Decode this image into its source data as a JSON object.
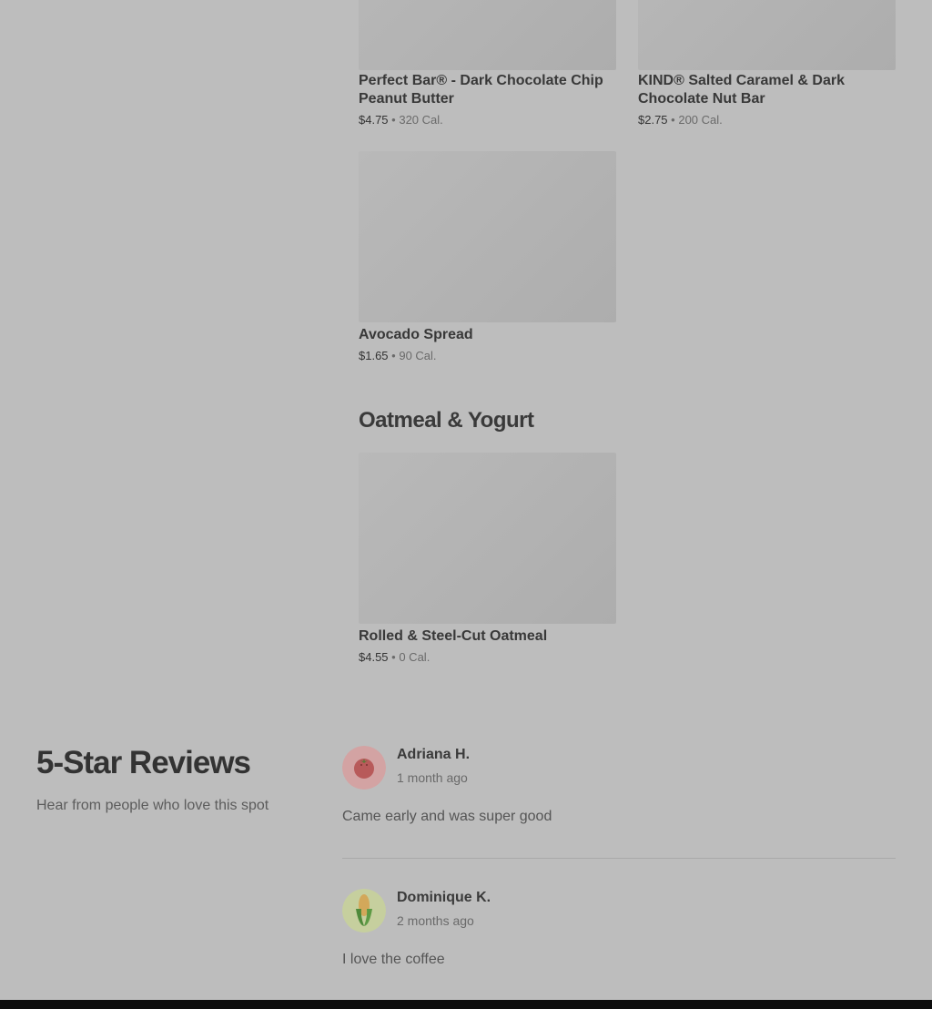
{
  "menu": {
    "items": [
      {
        "name": "Perfect Bar® - Dark Chocolate Chip Peanut Butter",
        "price": "$4.75",
        "calories": "320 Cal."
      },
      {
        "name": "KIND® Salted Caramel & Dark Chocolate Nut Bar",
        "price": "$2.75",
        "calories": "200 Cal."
      },
      {
        "name": "Avocado Spread",
        "price": "$1.65",
        "calories": "90 Cal."
      }
    ],
    "separator": "•",
    "section": {
      "title": "Oatmeal & Yogurt",
      "items": [
        {
          "name": "Rolled & Steel-Cut Oatmeal",
          "price": "$4.55",
          "calories": "0 Cal."
        }
      ]
    }
  },
  "reviews": {
    "title": "5-Star Reviews",
    "subtitle": "Hear from people who love this spot",
    "items": [
      {
        "author": "Adriana H.",
        "time": "1 month ago",
        "text": "Came early and was super good",
        "avatar_icon": "tomato-icon"
      },
      {
        "author": "Dominique K.",
        "time": "2 months ago",
        "text": "I love the coffee",
        "avatar_icon": "corn-icon"
      }
    ]
  },
  "colors": {
    "background": "#bdbdbd",
    "footer": "#0d0d0d",
    "tomato_avatar_bg": "#d3a3a3",
    "corn_avatar_bg": "#c6cf9e"
  }
}
